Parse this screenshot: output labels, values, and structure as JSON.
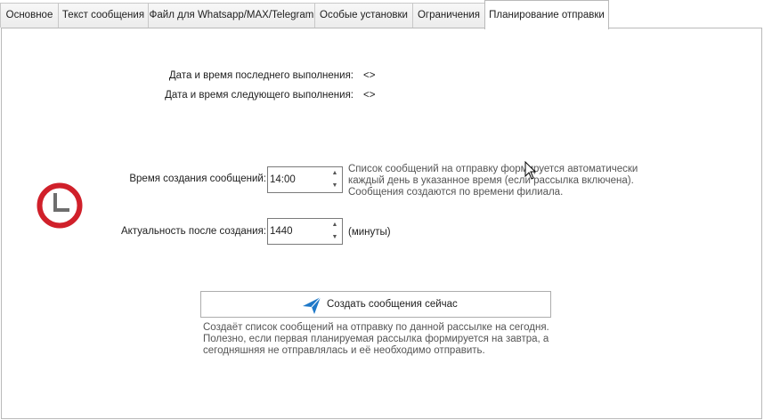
{
  "tabs": [
    {
      "label": "Основное"
    },
    {
      "label": "Текст сообщения"
    },
    {
      "label": "Файл для Whatsapp/MAX/Telegram"
    },
    {
      "label": "Особые установки"
    },
    {
      "label": "Ограничения"
    },
    {
      "label": "Планирование отправки",
      "active": true
    }
  ],
  "schedule": {
    "last_run_label": "Дата и время последнего выполнения:",
    "last_run_value": "<>",
    "next_run_label": "Дата и время следующего выполнения:",
    "next_run_value": "<>",
    "create_time_label": "Время создания сообщений:",
    "create_time_value": "14:00",
    "create_time_hint": [
      "Список сообщений на отправку формируется автоматически",
      "каждый день в указанное время (если рассылка включена).",
      "Сообщения создаются по времени филиала."
    ],
    "relevance_label": "Актуальность после создания:",
    "relevance_value": "1440",
    "relevance_unit": "(минуты)",
    "create_now_button": "Создать сообщения сейчас",
    "create_now_hint": [
      "Создаёт список сообщений на отправку по данной рассылке на сегодня.",
      "Полезно, если первая планируемая рассылка формируется на завтра, а",
      "сегодняшняя не отправлялась и её необходимо отправить."
    ]
  },
  "colors": {
    "clock_red": "#d0202a",
    "clock_hand": "#6e6e6e",
    "plane_blue": "#1e78c8",
    "hint_text": "#555555"
  },
  "icons": {
    "clock": "clock-icon",
    "send": "paper-plane-icon",
    "spin_up": "chevron-up-icon",
    "spin_down": "chevron-down-icon"
  }
}
